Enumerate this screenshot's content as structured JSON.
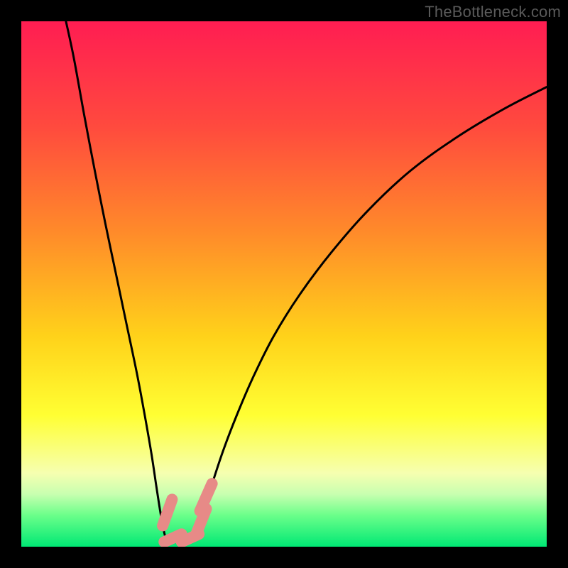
{
  "watermark": "TheBottleneck.com",
  "chart_data": {
    "type": "line",
    "title": "",
    "xlabel": "",
    "ylabel": "",
    "xlim": [
      0,
      100
    ],
    "ylim": [
      0,
      100
    ],
    "gradient_stops": [
      {
        "offset": 0,
        "color": "#ff1d52"
      },
      {
        "offset": 20,
        "color": "#ff4a3e"
      },
      {
        "offset": 40,
        "color": "#ff8a2a"
      },
      {
        "offset": 60,
        "color": "#ffd21a"
      },
      {
        "offset": 75,
        "color": "#ffff33"
      },
      {
        "offset": 86,
        "color": "#f6ffb0"
      },
      {
        "offset": 90,
        "color": "#c8ffb0"
      },
      {
        "offset": 94,
        "color": "#6bff8a"
      },
      {
        "offset": 100,
        "color": "#00e874"
      }
    ],
    "series": [
      {
        "name": "left-branch",
        "x": [
          8.5,
          10,
          12,
          14,
          16,
          18,
          20,
          22,
          23.5,
          24.8,
          25.7,
          26.4,
          27,
          27.5
        ],
        "values": [
          100,
          93,
          82,
          71.5,
          61.5,
          52,
          42.5,
          33,
          25,
          17.5,
          11.5,
          7,
          3.6,
          1.5
        ]
      },
      {
        "name": "right-branch",
        "x": [
          33.5,
          34,
          35,
          36.5,
          38.5,
          41,
          44,
          48,
          53,
          59,
          66,
          74,
          83,
          92,
          100
        ],
        "values": [
          1.5,
          3.5,
          7.5,
          12.5,
          18.5,
          25,
          32,
          40,
          48,
          56,
          64,
          71.5,
          78,
          83.4,
          87.5
        ]
      }
    ],
    "flat_bottom": {
      "x0": 27.5,
      "x1": 33.5,
      "y": 1.5
    },
    "markers": [
      {
        "name": "left-top",
        "x0": 26.9,
        "y0": 4.0,
        "x1": 28.7,
        "y1": 9.0
      },
      {
        "name": "bottom-left",
        "x0": 27.2,
        "y0": 0.9,
        "x1": 30.5,
        "y1": 2.4
      },
      {
        "name": "bottom-right",
        "x0": 30.5,
        "y0": 0.9,
        "x1": 33.8,
        "y1": 2.4
      },
      {
        "name": "right-lower",
        "x0": 33.2,
        "y0": 2.2,
        "x1": 35.2,
        "y1": 7.2
      },
      {
        "name": "right-upper",
        "x0": 34.0,
        "y0": 6.8,
        "x1": 36.3,
        "y1": 12.0
      }
    ],
    "marker_style": {
      "fill": "#e78a87",
      "radius_px": 8
    }
  }
}
